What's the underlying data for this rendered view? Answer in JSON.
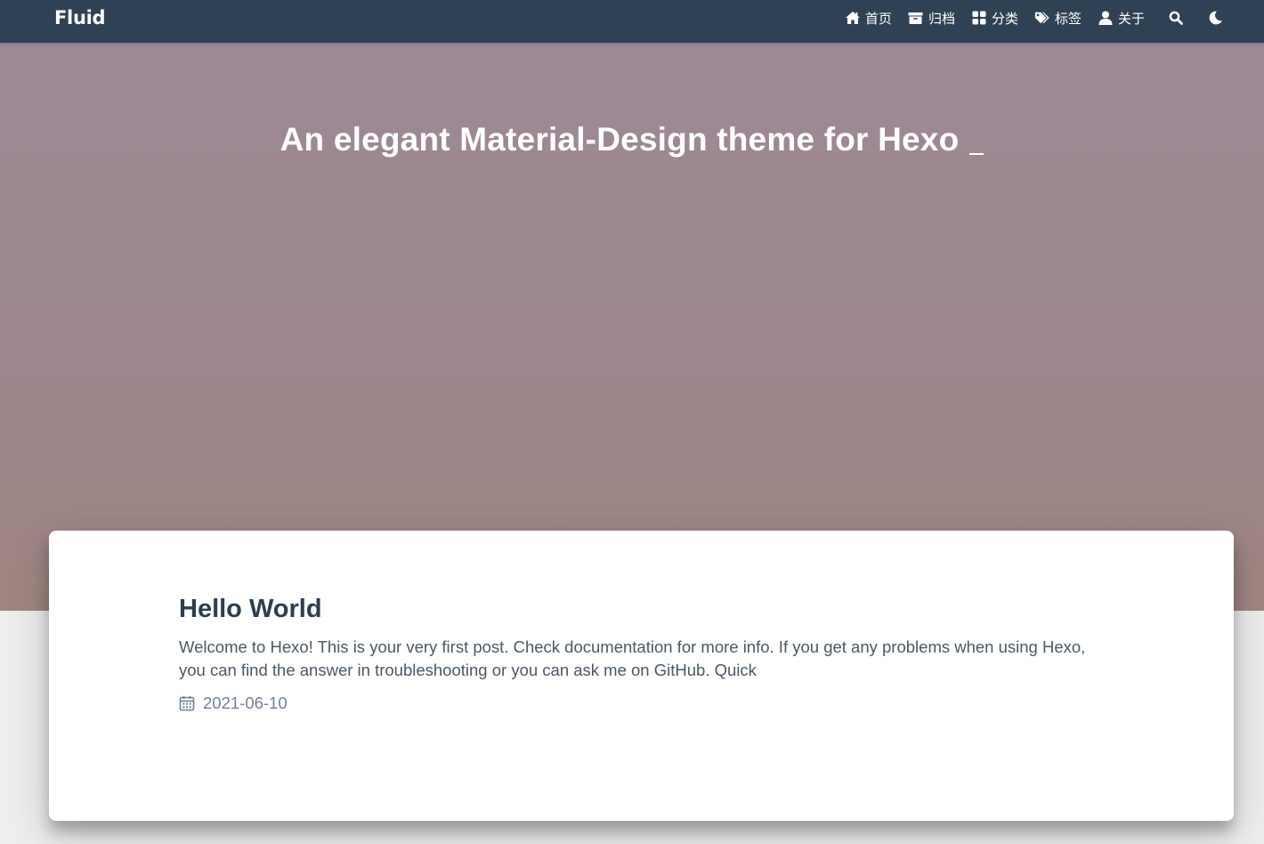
{
  "navbar": {
    "brand": "Fluid",
    "items": [
      {
        "icon": "home-icon",
        "label": "首页"
      },
      {
        "icon": "archive-icon",
        "label": "归档"
      },
      {
        "icon": "category-icon",
        "label": "分类"
      },
      {
        "icon": "tags-icon",
        "label": "标签"
      },
      {
        "icon": "user-icon",
        "label": "关于"
      }
    ],
    "search_icon": "search-icon",
    "theme_icon": "moon-icon"
  },
  "banner": {
    "subtitle": "An elegant Material-Design theme for Hexo"
  },
  "posts": [
    {
      "title": "Hello World",
      "excerpt": "Welcome to Hexo! This is your very first post. Check documentation for more info. If you get any problems when using Hexo, you can find the answer in troubleshooting or you can ask me on GitHub. Quick",
      "date": "2021-06-10",
      "date_icon": "calendar-icon"
    }
  ],
  "colors": {
    "navbar_bg": "#2f4154",
    "banner_top": "#9d8a96",
    "banner_bottom": "#a08681",
    "page_bg": "#eeeeee",
    "title_text": "#2c3e50",
    "meta_text": "#718096"
  }
}
